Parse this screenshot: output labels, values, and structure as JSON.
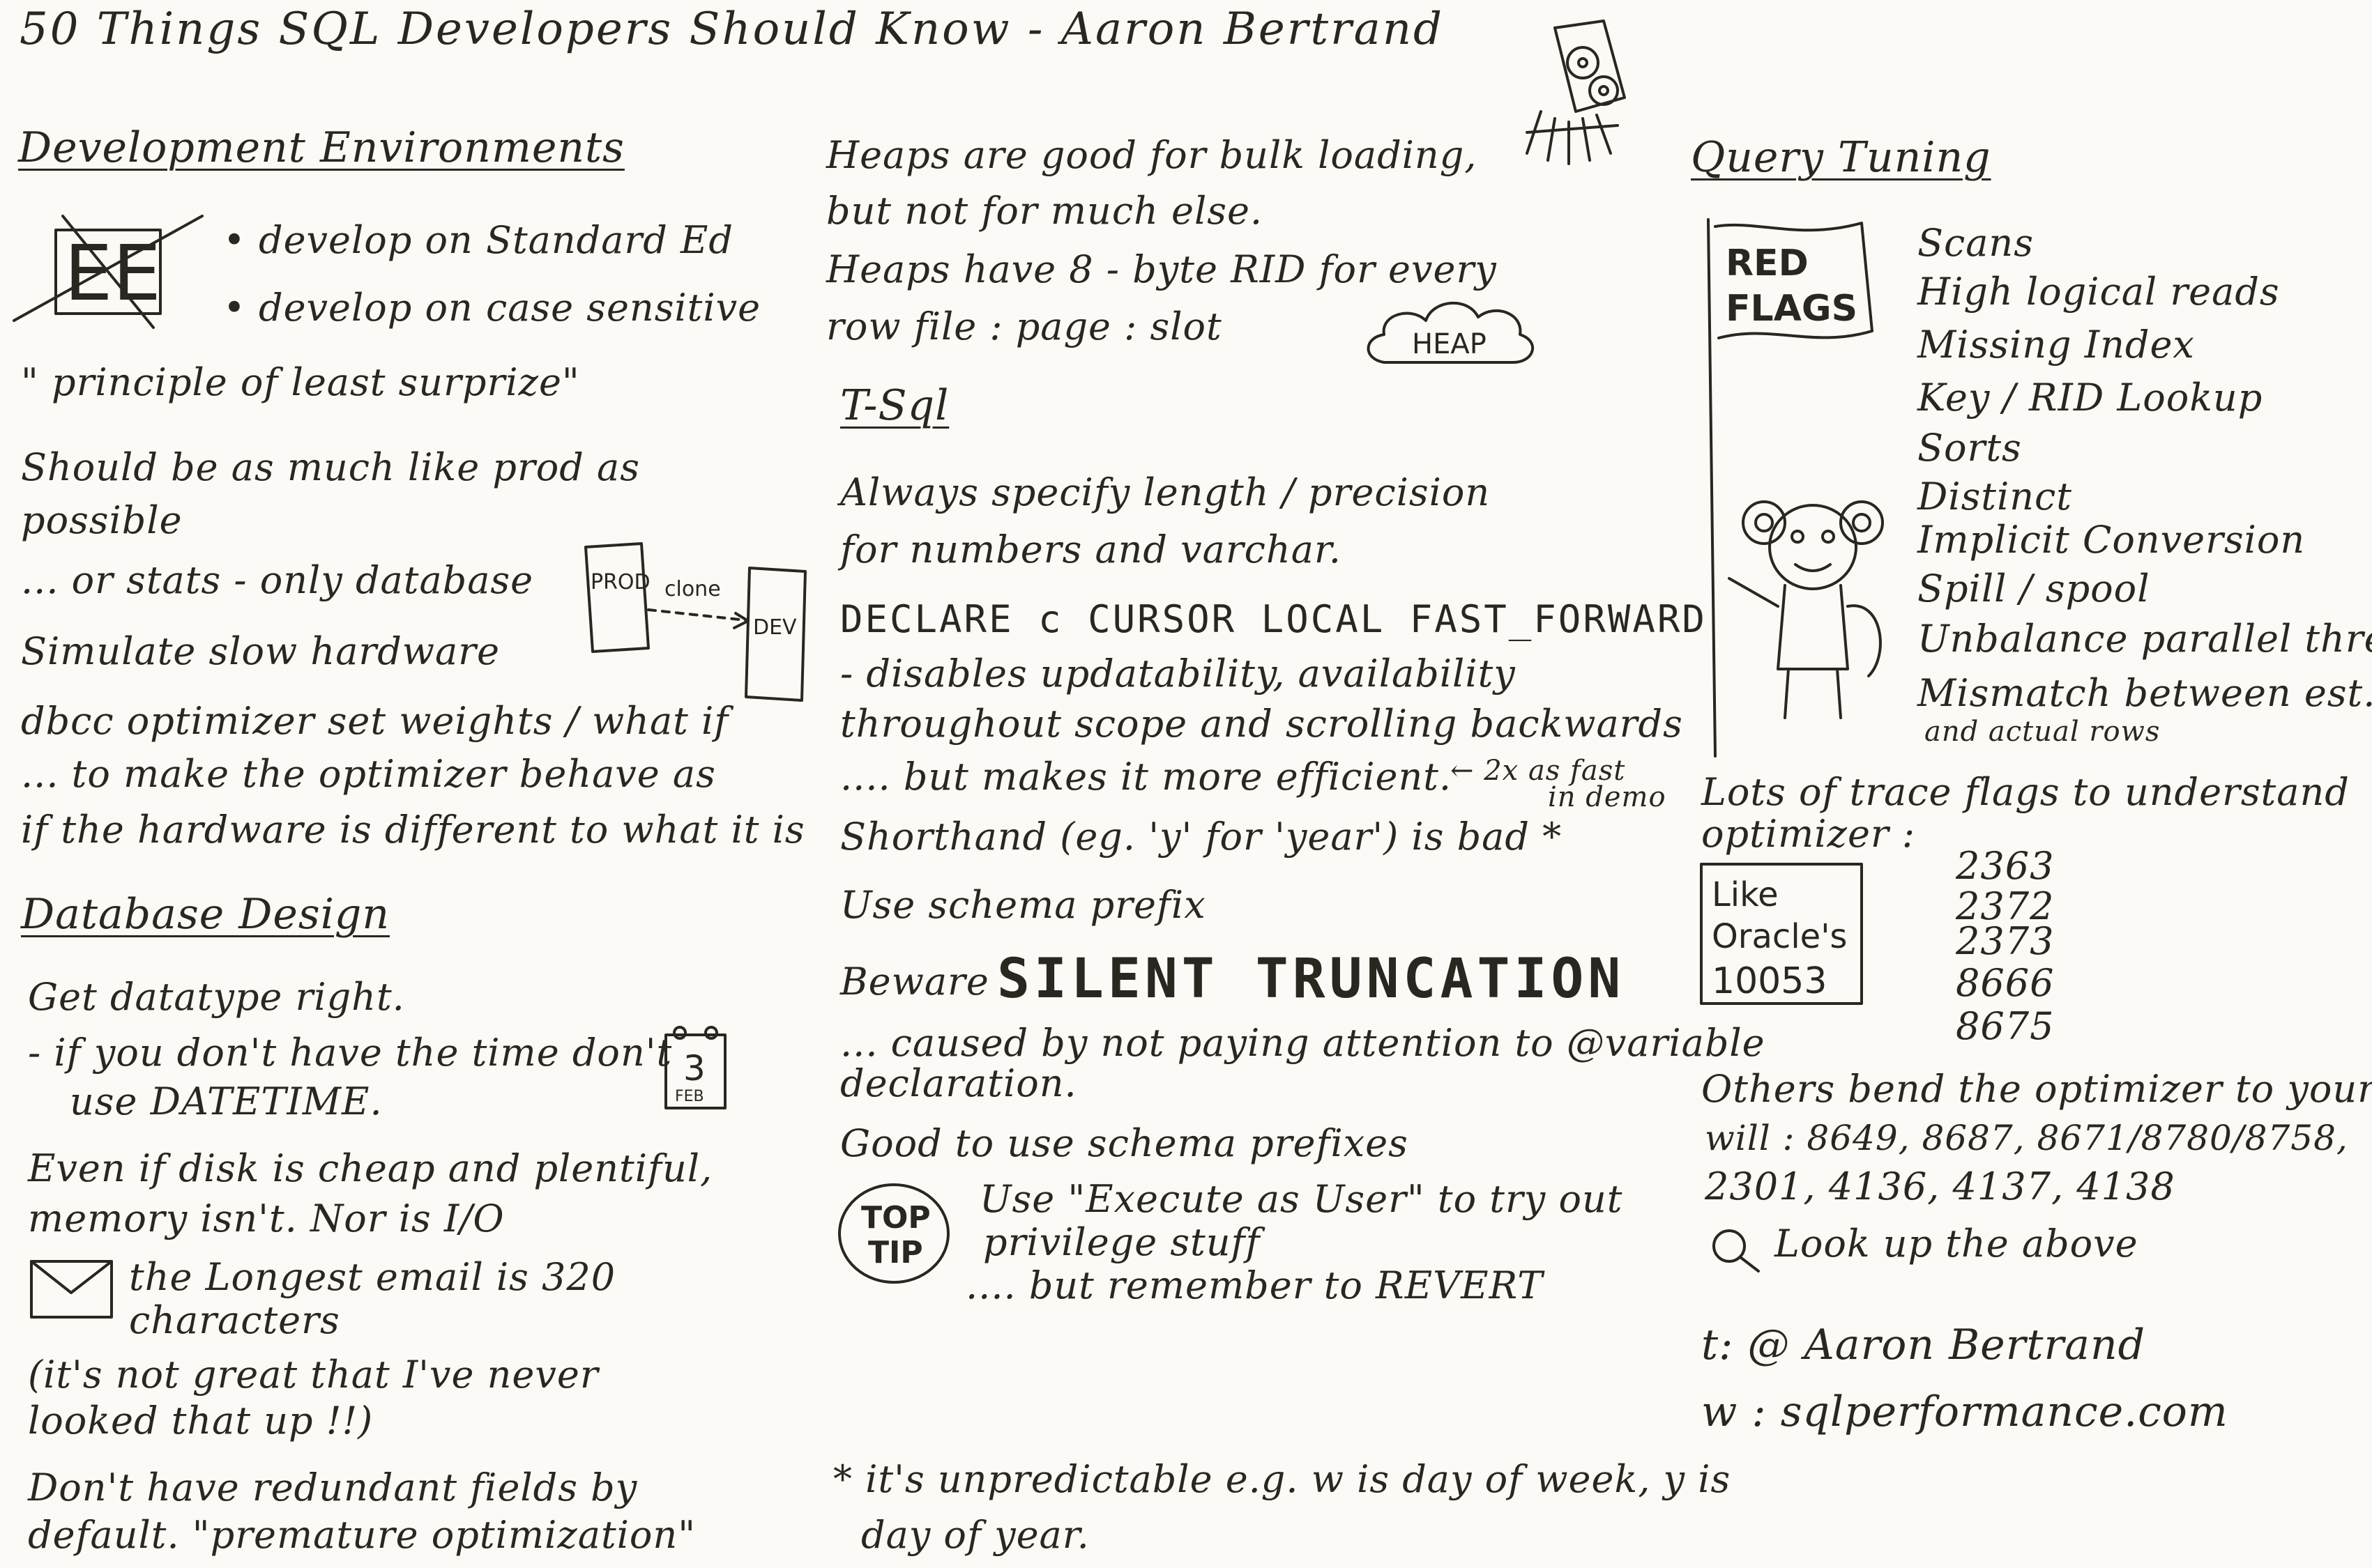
{
  "title": "50 Things SQL Developers Should Know - Aaron Bertrand",
  "dev_env": {
    "heading": "Development Environments",
    "icon_letters": "EE",
    "bullets": [
      "• develop on Standard Ed",
      "• develop on case sensitive"
    ],
    "quote": "\" principle of least surprize\"",
    "lines": [
      "Should be as much like prod as",
      "possible",
      "... or stats - only database",
      "Simulate slow hardware",
      "dbcc optimizer set weights / what if",
      "... to make the optimizer behave as",
      "if the hardware is different to what it is"
    ],
    "prod_label": "PROD",
    "clone_label": "clone",
    "dev_label": "DEV"
  },
  "db_design": {
    "heading": "Database Design",
    "lines": [
      "Get datatype right.",
      "- if you don't have the time don't",
      "use DATETIME.",
      "Even if disk is cheap and plentiful,",
      "memory isn't. Nor is I/O",
      "the Longest email is 320",
      "characters",
      "(it's not great that I've never",
      "looked that up !!)",
      "Don't have redundant fields by",
      "default. \"premature optimization\""
    ],
    "calendar_day": "3",
    "calendar_month": "FEB"
  },
  "heaps": {
    "lines": [
      "Heaps are good for bulk loading,",
      "but not for much else.",
      "Heaps have 8 - byte RID for every",
      "row   file : page : slot"
    ],
    "cloud_label": "HEAP"
  },
  "tsql": {
    "heading": "T-Sql",
    "lines": [
      "Always specify length / precision",
      "for numbers and varchar.",
      "DECLARE c CURSOR LOCAL FAST_FORWARD",
      "- disables updatability, availability",
      "throughout scope and scrolling backwards",
      ".... but makes it more efficient.",
      "Shorthand (eg. 'y' for 'year') is bad *",
      "Use schema prefix",
      "Beware",
      "... caused by not paying attention to @variable",
      "declaration.",
      "Good to use schema prefixes",
      "Use \"Execute as User\" to try out",
      "privilege stuff",
      ".... but remember to REVERT"
    ],
    "arrow_note": "← 2x as fast",
    "arrow_note2": "in demo",
    "silent_truncation": "SILENT TRUNCATION",
    "top_tip_1": "TOP",
    "top_tip_2": "TIP",
    "footnote": [
      "* it's unpredictable e.g. w is day of week, y is",
      "day of year."
    ]
  },
  "query_tuning": {
    "heading": "Query Tuning",
    "flag_text_1": "RED",
    "flag_text_2": "FLAGS",
    "flags": [
      "Scans",
      "High logical reads",
      "Missing Index",
      "Key / RID Lookup",
      "Sorts",
      "Distinct",
      "Implicit Conversion",
      "Spill / spool",
      "Unbalance parallel thread",
      "Mismatch between est.",
      "and actual rows"
    ],
    "trace_lines": [
      "Lots of trace flags to understand",
      "optimizer :"
    ],
    "oracle_box": [
      "Like",
      "Oracle's",
      "10053"
    ],
    "trace_flags": [
      "2363",
      "2372",
      "2373",
      "8666",
      "8675"
    ],
    "bend_lines": [
      "Others bend the optimizer to your",
      "will : 8649, 8687, 8671/8780/8758,",
      "2301, 4136, 4137, 4138"
    ],
    "look_up": "Look up the above",
    "twitter": "t: @ Aaron Bertrand",
    "website": "w : sqlperformance.com"
  }
}
